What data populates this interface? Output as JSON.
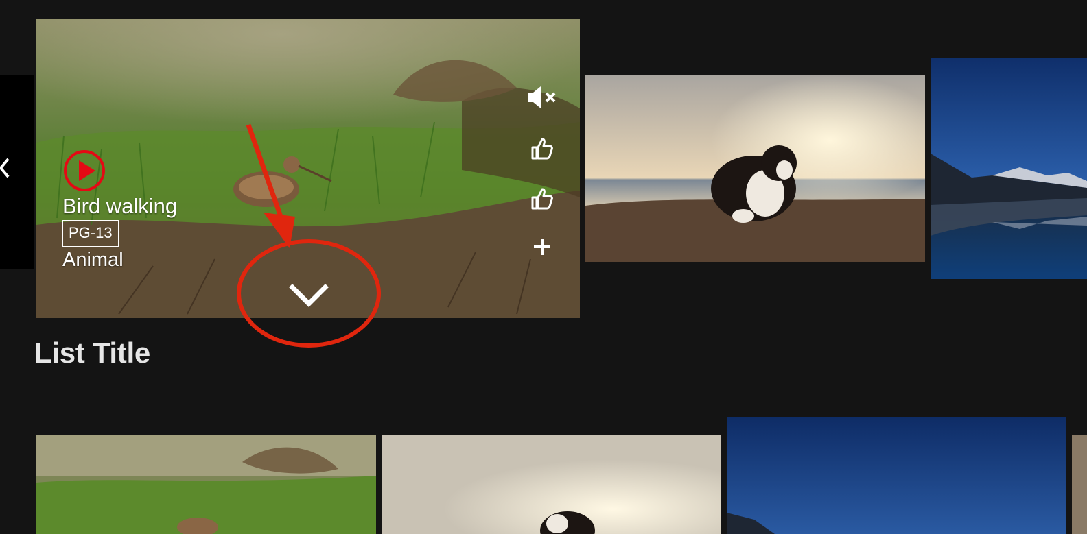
{
  "featured": {
    "title": "Bird walking",
    "rating": "PG-13",
    "genre": "Animal"
  },
  "icons": {
    "nav_prev": "chevron-left-icon",
    "play": "play-circle-icon",
    "mute": "speaker-muted-icon",
    "like": "thumbs-up-icon",
    "add": "plus-icon",
    "expand": "chevron-down-icon"
  },
  "list_title": "List Title",
  "colors": {
    "background": "#141414",
    "accent": "#e50914",
    "annotation": "#e0260e"
  }
}
